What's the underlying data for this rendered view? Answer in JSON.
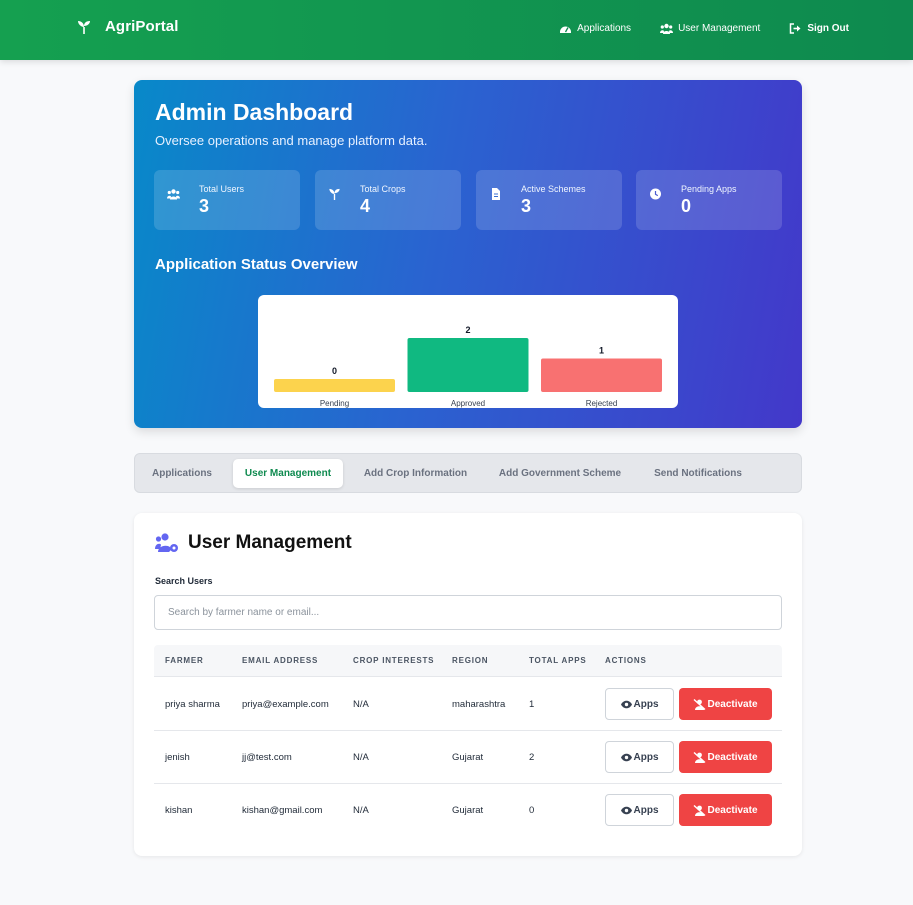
{
  "app": {
    "brand": "AgriPortal"
  },
  "nav": {
    "applications": "Applications",
    "user_management": "User Management",
    "sign_out": "Sign Out"
  },
  "hero": {
    "title": "Admin Dashboard",
    "subtitle": "Oversee operations and manage platform data.",
    "stats": [
      {
        "label": "Total Users",
        "value": "3",
        "icon": "users-icon"
      },
      {
        "label": "Total Crops",
        "value": "4",
        "icon": "seedling-icon"
      },
      {
        "label": "Active Schemes",
        "value": "3",
        "icon": "document-icon"
      },
      {
        "label": "Pending Apps",
        "value": "0",
        "icon": "clock-icon"
      }
    ],
    "overview_title": "Application Status Overview"
  },
  "chart_data": {
    "type": "bar",
    "categories": [
      "Pending",
      "Approved",
      "Rejected"
    ],
    "values": [
      0,
      2,
      1
    ],
    "colors": [
      "#fcd34d",
      "#10b981",
      "#f87171"
    ],
    "grid": false,
    "legend": "none"
  },
  "tabs": [
    {
      "label": "Applications",
      "active": false
    },
    {
      "label": "User Management",
      "active": true
    },
    {
      "label": "Add Crop Information",
      "active": false
    },
    {
      "label": "Add Government Scheme",
      "active": false
    },
    {
      "label": "Send Notifications",
      "active": false
    }
  ],
  "panel": {
    "title": "User Management",
    "search_label": "Search Users",
    "search_placeholder": "Search by farmer name or email...",
    "search_value": ""
  },
  "table": {
    "headers": [
      "FARMER",
      "EMAIL ADDRESS",
      "CROP INTERESTS",
      "REGION",
      "TOTAL APPS",
      "ACTIONS"
    ],
    "rows": [
      {
        "farmer": "priya sharma",
        "email": "priya@example.com",
        "crops": "N/A",
        "region": "maharashtra",
        "apps": "1"
      },
      {
        "farmer": "jenish",
        "email": "jj@test.com",
        "crops": "N/A",
        "region": "Gujarat",
        "apps": "2"
      },
      {
        "farmer": "kishan",
        "email": "kishan@gmail.com",
        "crops": "N/A",
        "region": "Gujarat",
        "apps": "0"
      }
    ],
    "apps_button": "Apps",
    "deactivate_button": "Deactivate"
  },
  "colors": {
    "navbar": "#0e8a4f",
    "accent_green": "#0e8a4f",
    "danger": "#ef4444",
    "hero_start": "#0889c9",
    "hero_end": "#4338ca"
  }
}
